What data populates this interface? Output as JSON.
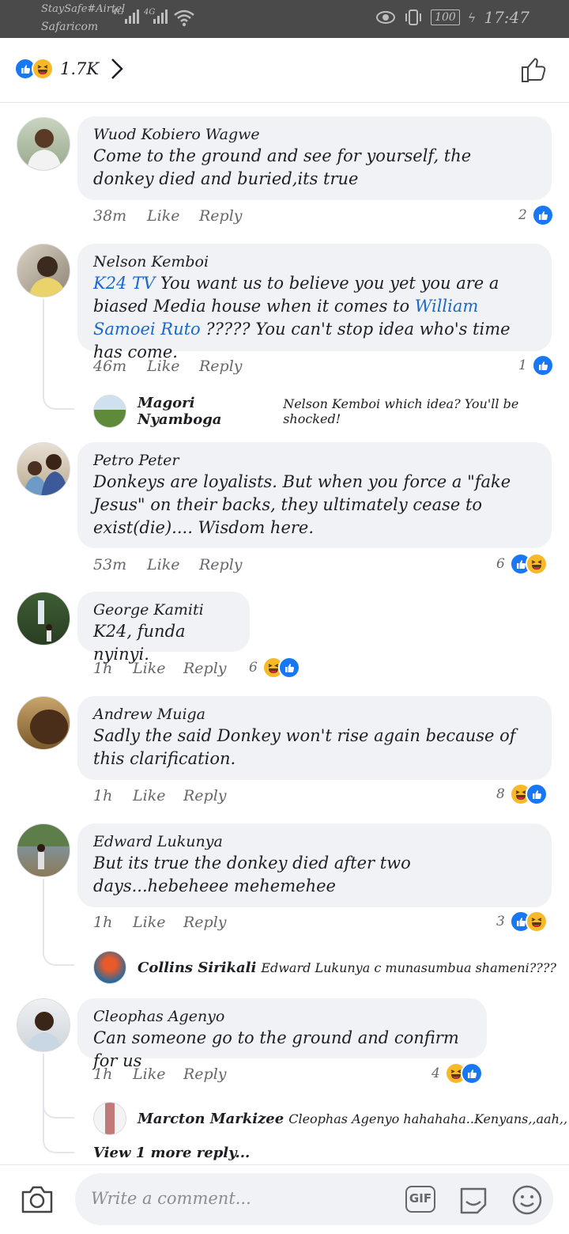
{
  "status_bar": {
    "carrier_line1": "StaySafe#Airtel",
    "carrier_line2": "Safaricom",
    "network1": "4G",
    "network2": "4G",
    "battery": "100",
    "time": "17:47"
  },
  "header": {
    "reaction_count": "1.7K"
  },
  "comments": [
    {
      "name": "Wuod Kobiero Wagwe",
      "text": "Come to the ground and see for  yourself, the donkey died and buried,its true",
      "time": "38m",
      "like": "Like",
      "reply": "Reply",
      "reactions": "2"
    },
    {
      "name": "Nelson Kemboi",
      "mention1": "K24 TV",
      "text_part1": " You want us to believe you yet you are a biased Media house when it comes to ",
      "mention2": "William Samoei Ruto",
      "text_part2": " ????? You can't stop idea who's time has come.",
      "time": "46m",
      "like": "Like",
      "reply": "Reply",
      "reactions": "1",
      "reply_preview": {
        "name": "Magori Nyamboga",
        "text": "Nelson Kemboi which idea? You'll be shocked!"
      }
    },
    {
      "name": "Petro Peter",
      "text": "Donkeys are loyalists. But when you force a \"fake Jesus\" on their backs, they ultimately cease to exist(die).... Wisdom here.",
      "time": "53m",
      "like": "Like",
      "reply": "Reply",
      "reactions": "6"
    },
    {
      "name": "George Kamiti",
      "text": "K24, funda nyinyi.",
      "time": "1h",
      "like": "Like",
      "reply": "Reply",
      "reactions": "6"
    },
    {
      "name": "Andrew Muiga",
      "text": "Sadly the said Donkey won't rise again because of this clarification.",
      "time": "1h",
      "like": "Like",
      "reply": "Reply",
      "reactions": "8"
    },
    {
      "name": "Edward Lukunya",
      "text": "But its true the donkey died after two days...hebeheee mehemehee",
      "time": "1h",
      "like": "Like",
      "reply": "Reply",
      "reactions": "3",
      "reply_preview": {
        "name": "Collins Sirikali",
        "text": "Edward Lukunya c munasumbua shameni????"
      }
    },
    {
      "name": "Cleophas Agenyo",
      "text": "Can someone go to the ground and confirm for us",
      "time": "1h",
      "like": "Like",
      "reply": "Reply",
      "reactions": "4",
      "reply_preview": {
        "name": "Marcton Markizee",
        "text": "Cleophas Agenyo hahahaha..Kenyans,,aah,,"
      },
      "view_more": "View 1 more reply..."
    }
  ],
  "composer": {
    "placeholder": "Write a comment...",
    "gif_label": "GIF"
  },
  "colors": {
    "like_blue": "#1877f2",
    "haha_yellow": "#f7b928",
    "mention_blue": "#1a68c9",
    "bubble_bg": "#f0f2f5"
  },
  "icons": [
    "eye-icon",
    "vibrate-icon",
    "charging-icon",
    "wifi-icon",
    "chevron-right-icon",
    "thumbs-up-icon",
    "camera-icon",
    "gif-icon",
    "sticker-icon",
    "emoji-icon",
    "like-reaction-icon",
    "haha-reaction-icon"
  ]
}
